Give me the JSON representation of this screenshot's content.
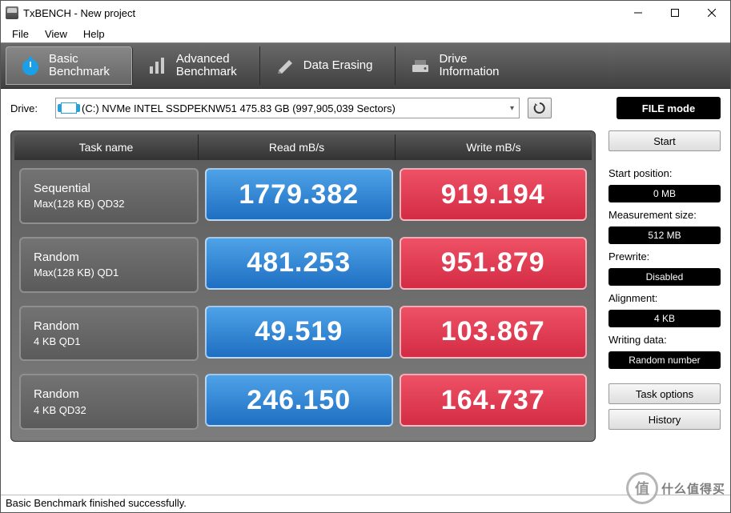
{
  "window": {
    "title": "TxBENCH - New project"
  },
  "menu": {
    "file": "File",
    "view": "View",
    "help": "Help"
  },
  "tabs": {
    "basic": {
      "line1": "Basic",
      "line2": "Benchmark"
    },
    "advanced": {
      "line1": "Advanced",
      "line2": "Benchmark"
    },
    "erasing": {
      "label": "Data Erasing"
    },
    "info": {
      "line1": "Drive",
      "line2": "Information"
    }
  },
  "drive": {
    "label": "Drive:",
    "selected": "(C:) NVMe INTEL SSDPEKNW51  475.83 GB (997,905,039 Sectors)"
  },
  "mode_button": "FILE mode",
  "headers": {
    "task": "Task name",
    "read": "Read mB/s",
    "write": "Write mB/s"
  },
  "chart_data": {
    "type": "table",
    "title": "Basic Benchmark Results",
    "columns": [
      "Task name",
      "Read mB/s",
      "Write mB/s"
    ],
    "rows": [
      {
        "task_line1": "Sequential",
        "task_line2": "Max(128 KB) QD32",
        "read": "1779.382",
        "write": "919.194"
      },
      {
        "task_line1": "Random",
        "task_line2": "Max(128 KB) QD1",
        "read": "481.253",
        "write": "951.879"
      },
      {
        "task_line1": "Random",
        "task_line2": "4 KB QD1",
        "read": "49.519",
        "write": "103.867"
      },
      {
        "task_line1": "Random",
        "task_line2": "4 KB QD32",
        "read": "246.150",
        "write": "164.737"
      }
    ]
  },
  "sidebar": {
    "start": "Start",
    "start_position_label": "Start position:",
    "start_position_value": "0 MB",
    "measurement_label": "Measurement size:",
    "measurement_value": "512 MB",
    "prewrite_label": "Prewrite:",
    "prewrite_value": "Disabled",
    "alignment_label": "Alignment:",
    "alignment_value": "4 KB",
    "writing_label": "Writing data:",
    "writing_value": "Random number",
    "task_options": "Task options",
    "history": "History"
  },
  "status": "Basic Benchmark finished successfully.",
  "watermark": {
    "badge": "值",
    "text": "什么值得买"
  }
}
